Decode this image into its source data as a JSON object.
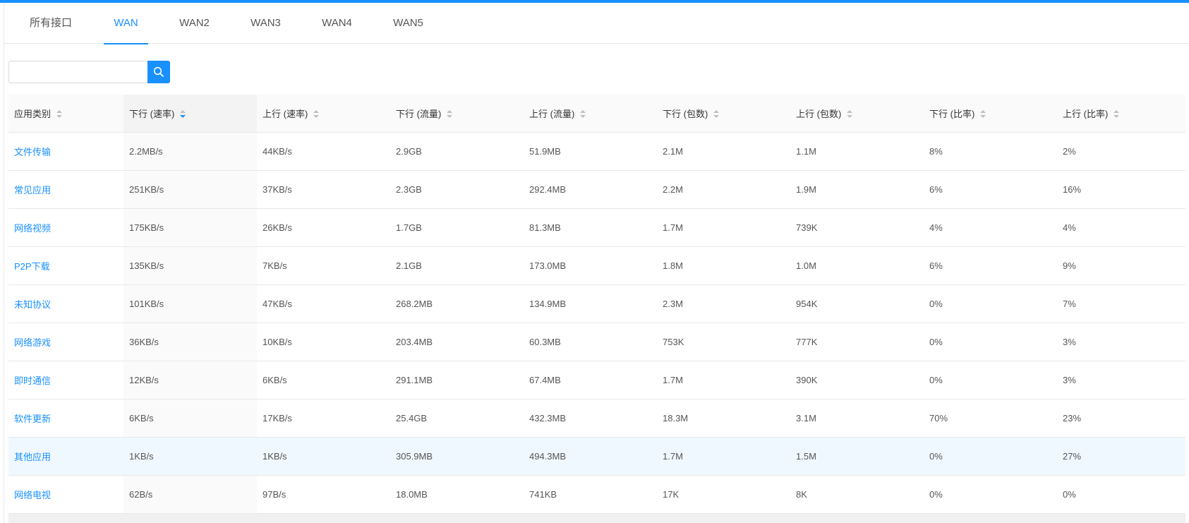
{
  "tabs": [
    {
      "label": "所有接口",
      "active": false
    },
    {
      "label": "WAN",
      "active": true
    },
    {
      "label": "WAN2",
      "active": false
    },
    {
      "label": "WAN3",
      "active": false
    },
    {
      "label": "WAN4",
      "active": false
    },
    {
      "label": "WAN5",
      "active": false
    }
  ],
  "search": {
    "value": "",
    "placeholder": "",
    "icon": "search-icon"
  },
  "table": {
    "columns": [
      "应用类别",
      "下行 (速率)",
      "上行 (速率)",
      "下行 (流量)",
      "上行 (流量)",
      "下行 (包数)",
      "上行 (包数)",
      "下行 (比率)",
      "上行 (比率)"
    ],
    "sorted_column": "下行 (速率)",
    "sort_order": "descending",
    "rows": [
      [
        "文件传输",
        "2.2MB/s",
        "44KB/s",
        "2.9GB",
        "51.9MB",
        "2.1M",
        "1.1M",
        "8%",
        "2%"
      ],
      [
        "常见应用",
        "251KB/s",
        "37KB/s",
        "2.3GB",
        "292.4MB",
        "2.2M",
        "1.9M",
        "6%",
        "16%"
      ],
      [
        "网络视频",
        "175KB/s",
        "26KB/s",
        "1.7GB",
        "81.3MB",
        "1.7M",
        "739K",
        "4%",
        "4%"
      ],
      [
        "P2P下载",
        "135KB/s",
        "7KB/s",
        "2.1GB",
        "173.0MB",
        "1.8M",
        "1.0M",
        "6%",
        "9%"
      ],
      [
        "未知协议",
        "101KB/s",
        "47KB/s",
        "268.2MB",
        "134.9MB",
        "2.3M",
        "954K",
        "0%",
        "7%"
      ],
      [
        "网络游戏",
        "36KB/s",
        "10KB/s",
        "203.4MB",
        "60.3MB",
        "753K",
        "777K",
        "0%",
        "3%"
      ],
      [
        "即时通信",
        "12KB/s",
        "6KB/s",
        "291.1MB",
        "67.4MB",
        "1.7M",
        "390K",
        "0%",
        "3%"
      ],
      [
        "软件更新",
        "6KB/s",
        "17KB/s",
        "25.4GB",
        "432.3MB",
        "18.3M",
        "3.1M",
        "70%",
        "23%"
      ],
      [
        "其他应用",
        "1KB/s",
        "1KB/s",
        "305.9MB",
        "494.3MB",
        "1.7M",
        "1.5M",
        "0%",
        "27%"
      ],
      [
        "网络电视",
        "62B/s",
        "97B/s",
        "18.0MB",
        "741KB",
        "17K",
        "8K",
        "0%",
        "0%"
      ]
    ]
  },
  "colors": {
    "accent": "#1890ff",
    "header_bg": "#fafafa",
    "hover_row_bg": "#f0f8ff",
    "border": "#e8e8e8"
  }
}
